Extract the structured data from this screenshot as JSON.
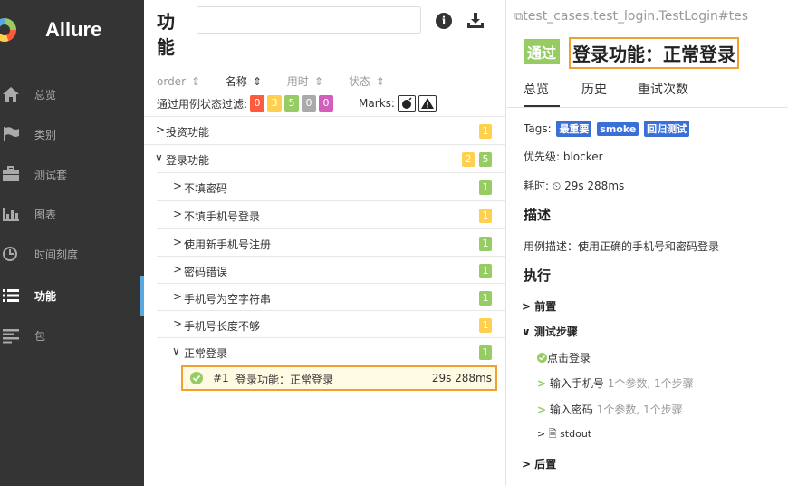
{
  "sidebar": {
    "brand": "Allure",
    "items": [
      {
        "label": "总览",
        "icon": "home-icon"
      },
      {
        "label": "类别",
        "icon": "flag-icon"
      },
      {
        "label": "测试套",
        "icon": "briefcase-icon"
      },
      {
        "label": "图表",
        "icon": "bar-chart-icon"
      },
      {
        "label": "时间刻度",
        "icon": "clock-icon"
      },
      {
        "label": "功能",
        "icon": "list-icon",
        "active": true
      },
      {
        "label": "包",
        "icon": "align-left-icon"
      }
    ]
  },
  "middle": {
    "title": "功能",
    "search": {
      "value": "",
      "placeholder": ""
    },
    "sort": {
      "order": "order",
      "name": "名称",
      "duration": "用时",
      "status": "状态"
    },
    "filter": {
      "label": "通过用例状态过滤:",
      "counts": [
        {
          "value": "0",
          "color": "#fd5a3e"
        },
        {
          "value": "3",
          "color": "#ffd050"
        },
        {
          "value": "5",
          "color": "#97cc64"
        },
        {
          "value": "0",
          "color": "#aaaaaa"
        },
        {
          "value": "0",
          "color": "#d35ebe"
        }
      ],
      "marks_label": "Marks:"
    },
    "tree": [
      {
        "label": "投资功能",
        "chev": ">",
        "badges": [
          {
            "v": "1",
            "c": "yellow"
          }
        ]
      },
      {
        "label": "登录功能",
        "chev": "v",
        "badges": [
          {
            "v": "2",
            "c": "yellow"
          },
          {
            "v": "5",
            "c": "green"
          }
        ]
      },
      {
        "label": "不填密码",
        "chev": ">",
        "badges": [
          {
            "v": "1",
            "c": "green"
          }
        ]
      },
      {
        "label": "不填手机号登录",
        "chev": ">",
        "badges": [
          {
            "v": "1",
            "c": "yellow"
          }
        ]
      },
      {
        "label": "使用新手机号注册",
        "chev": ">",
        "badges": [
          {
            "v": "1",
            "c": "green"
          }
        ]
      },
      {
        "label": "密码错误",
        "chev": ">",
        "badges": [
          {
            "v": "1",
            "c": "green"
          }
        ]
      },
      {
        "label": "手机号为空字符串",
        "chev": ">",
        "badges": [
          {
            "v": "1",
            "c": "green"
          }
        ]
      },
      {
        "label": "手机号长度不够",
        "chev": ">",
        "badges": [
          {
            "v": "1",
            "c": "yellow"
          }
        ]
      },
      {
        "label": "正常登录",
        "chev": "v",
        "badges": [
          {
            "v": "1",
            "c": "green"
          }
        ]
      }
    ],
    "selected_test": {
      "num": "#1",
      "name": "登录功能：正常登录",
      "duration": "29s 288ms"
    }
  },
  "right": {
    "path": "test_cases.test_login.TestLogin#tes",
    "status": "通过",
    "title": "登录功能：正常登录",
    "tabs": [
      "总览",
      "历史",
      "重试次数"
    ],
    "tags_label": "Tags:",
    "tags": [
      "最重要",
      "smoke",
      "回归测试"
    ],
    "severity": "优先级: blocker",
    "duration_label": "耗时:",
    "duration": "29s 288ms",
    "desc_head": "描述",
    "desc": "用例描述：使用正确的手机号和密码登录",
    "exec_head": "执行",
    "before": "前置",
    "steps_head": "测试步骤",
    "steps": [
      {
        "label": "点击登录",
        "extra": ""
      },
      {
        "label": "输入手机号",
        "extra": "1个参数, 1个步骤"
      },
      {
        "label": "输入密码",
        "extra": "1个参数, 1个步骤"
      }
    ],
    "stdout": "stdout",
    "after": "后置"
  }
}
